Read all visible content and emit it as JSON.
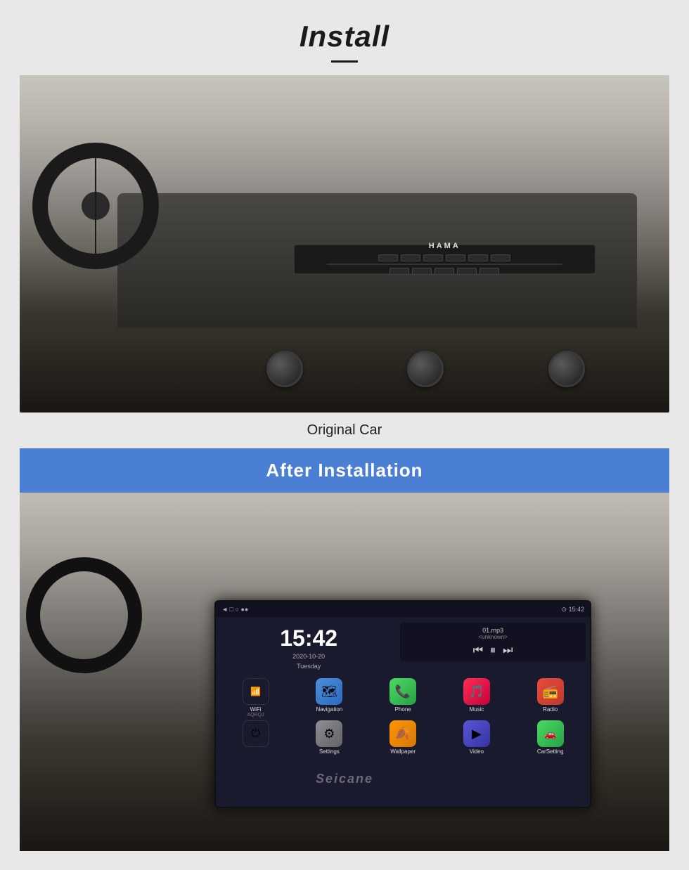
{
  "page": {
    "background_color": "#e8e8e8"
  },
  "header": {
    "title": "Install",
    "title_style": "bold italic"
  },
  "original_car": {
    "caption": "Original Car",
    "image_alt": "Car interior with original factory radio unit"
  },
  "after_installation": {
    "banner_text": "After  Installation",
    "banner_bg": "#4a7fd4",
    "caption": "After Installation",
    "image_alt": "Car interior with Android touchscreen head unit installed"
  },
  "android_screen": {
    "status_left": "◄  □  ○  ●●",
    "status_right": "⊙  15:42",
    "time": "15:42",
    "date_line1": "2020-10-20",
    "date_line2": "Tuesday",
    "music_track": "01.mp3",
    "music_artist": "<unknown>",
    "wifi_name": "AQRQJ",
    "apps": [
      {
        "name": "Navigation",
        "icon_type": "maps",
        "symbol": "🗺"
      },
      {
        "name": "Phone",
        "icon_type": "phone",
        "symbol": "📞"
      },
      {
        "name": "Music",
        "icon_type": "music",
        "symbol": "🎵"
      },
      {
        "name": "Radio",
        "icon_type": "radio",
        "symbol": "📻"
      },
      {
        "name": "Settings",
        "icon_type": "settings",
        "symbol": "⚙"
      },
      {
        "name": "Wallpaper",
        "icon_type": "wallpaper",
        "symbol": "🔥"
      },
      {
        "name": "Video",
        "icon_type": "video",
        "symbol": "▶"
      },
      {
        "name": "CarSetting",
        "icon_type": "carsetting",
        "symbol": "🚗"
      }
    ]
  },
  "watermark": {
    "text": "Seicane"
  }
}
